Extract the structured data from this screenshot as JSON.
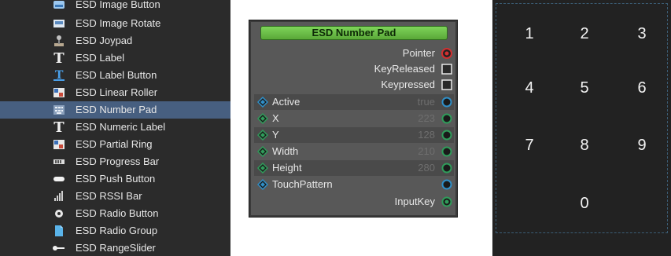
{
  "palette": {
    "items": [
      {
        "label": "ESD Image Button",
        "icon": "image-button-icon",
        "selected": false
      },
      {
        "label": "ESD Image Rotate",
        "icon": "image-rotate-icon",
        "selected": false
      },
      {
        "label": "ESD Joypad",
        "icon": "joystick-icon",
        "selected": false
      },
      {
        "label": "ESD Label",
        "icon": "text-icon",
        "selected": false
      },
      {
        "label": "ESD Label Button",
        "icon": "text-button-icon",
        "selected": false
      },
      {
        "label": "ESD Linear Roller",
        "icon": "roller-icon",
        "selected": false
      },
      {
        "label": "ESD Number Pad",
        "icon": "number-pad-icon",
        "selected": true
      },
      {
        "label": "ESD Numeric Label",
        "icon": "text-icon",
        "selected": false
      },
      {
        "label": "ESD Partial Ring",
        "icon": "partial-ring-icon",
        "selected": false
      },
      {
        "label": "ESD Progress Bar",
        "icon": "progress-bar-icon",
        "selected": false
      },
      {
        "label": "ESD Push Button",
        "icon": "push-button-icon",
        "selected": false
      },
      {
        "label": "ESD RSSI Bar",
        "icon": "rssi-bar-icon",
        "selected": false
      },
      {
        "label": "ESD Radio Button",
        "icon": "radio-button-icon",
        "selected": false
      },
      {
        "label": "ESD Radio Group",
        "icon": "radio-group-icon",
        "selected": false
      },
      {
        "label": "ESD RangeSlider",
        "icon": "range-slider-icon",
        "selected": false
      }
    ]
  },
  "node": {
    "title": "ESD Number Pad",
    "outputs": [
      {
        "label": "Pointer",
        "type": "pointer-pin-icon"
      },
      {
        "label": "KeyReleased",
        "type": "checkbox-pin-icon"
      },
      {
        "label": "Keypressed",
        "type": "checkbox-pin-icon"
      }
    ],
    "properties": [
      {
        "label": "Active",
        "value": "true",
        "pin": "blue"
      },
      {
        "label": "X",
        "value": "223",
        "pin": "green"
      },
      {
        "label": "Y",
        "value": "128",
        "pin": "green"
      },
      {
        "label": "Width",
        "value": "210",
        "pin": "green"
      },
      {
        "label": "Height",
        "value": "280",
        "pin": "green"
      },
      {
        "label": "TouchPattern",
        "value": "",
        "pin": "blue"
      }
    ],
    "final_output": {
      "label": "InputKey",
      "pin": "green"
    }
  },
  "numpad": {
    "keys": [
      "1",
      "2",
      "3",
      "4",
      "5",
      "6",
      "7",
      "8",
      "9",
      "0"
    ]
  },
  "colors": {
    "selection": "#475f80",
    "title_bar": "#6cc24a",
    "pin_green": "#2f9c5a",
    "pin_blue": "#2f8fc8",
    "pin_red": "#d23030"
  }
}
